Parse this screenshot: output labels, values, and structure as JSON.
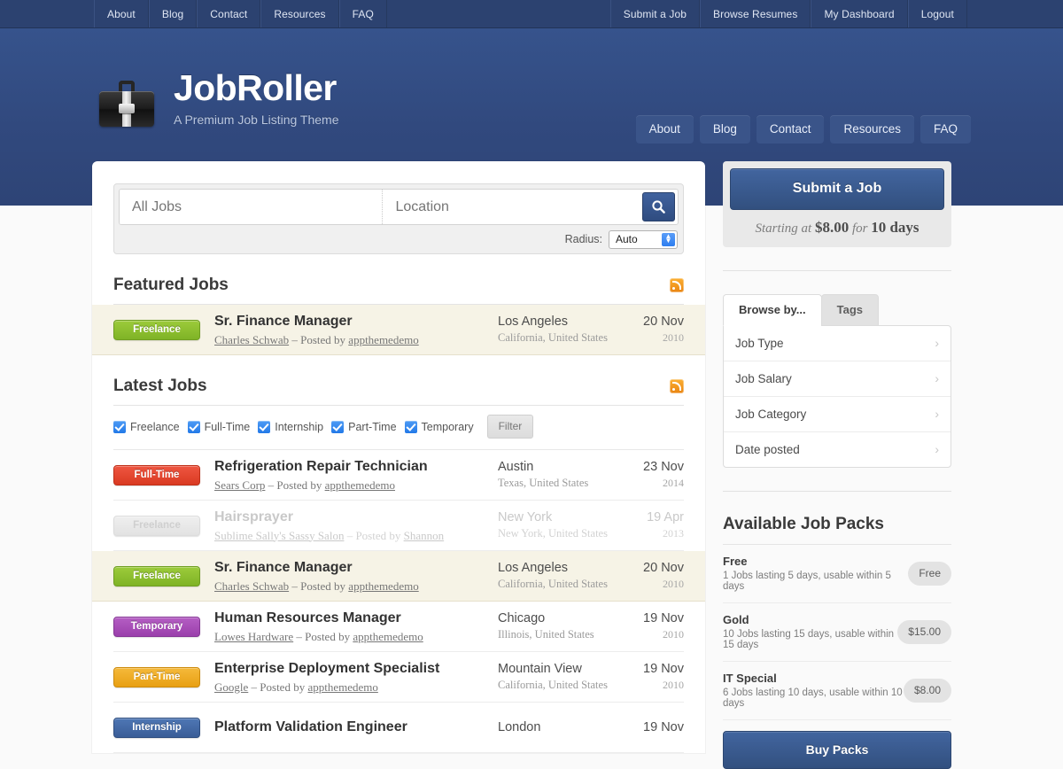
{
  "topbar": {
    "left_links": [
      "About",
      "Blog",
      "Contact",
      "Resources",
      "FAQ"
    ],
    "right_links": [
      "Submit a Job",
      "Browse Resumes",
      "My Dashboard",
      "Logout"
    ]
  },
  "header": {
    "logo_icon": "briefcase-icon",
    "title": "JobRoller",
    "tagline": "A Premium Job Listing Theme",
    "nav": [
      "About",
      "Blog",
      "Contact",
      "Resources",
      "FAQ"
    ],
    "background_color": "#31497e"
  },
  "search": {
    "keyword_placeholder": "All Jobs",
    "keyword_value": "",
    "location_placeholder": "Location",
    "location_value": "",
    "search_icon": "search-icon",
    "radius_label": "Radius:",
    "radius_value": "Auto"
  },
  "featured": {
    "heading": "Featured Jobs",
    "rss_icon": "rss-icon",
    "jobs": [
      {
        "badge": "Freelance",
        "badge_type": "freelance",
        "title": "Sr. Finance Manager",
        "company": "Charles Schwab",
        "posted_prefix": "– Posted by",
        "poster": "appthemedemo",
        "city": "Los Angeles",
        "region": "California, United States",
        "date_day": "20 Nov",
        "date_year": "2010"
      }
    ]
  },
  "latest": {
    "heading": "Latest Jobs",
    "rss_icon": "rss-icon",
    "filters": [
      {
        "label": "Freelance",
        "checked": true
      },
      {
        "label": "Full-Time",
        "checked": true
      },
      {
        "label": "Internship",
        "checked": true
      },
      {
        "label": "Part-Time",
        "checked": true
      },
      {
        "label": "Temporary",
        "checked": true
      }
    ],
    "filter_button": "Filter",
    "jobs": [
      {
        "badge": "Full-Time",
        "badge_type": "fulltime",
        "title": "Refrigeration Repair Technician",
        "company": "Sears Corp",
        "posted_prefix": "– Posted by",
        "poster": "appthemedemo",
        "city": "Austin",
        "region": "Texas, United States",
        "date_day": "23 Nov",
        "date_year": "2014",
        "state": "active"
      },
      {
        "badge": "Freelance",
        "badge_type": "expired",
        "title": "Hairsprayer",
        "company": "Sublime Sally's Sassy Salon",
        "posted_prefix": "– Posted by",
        "poster": "Shannon",
        "city": "New York",
        "region": "New York, United States",
        "date_day": "19 Apr",
        "date_year": "2013",
        "state": "expired"
      },
      {
        "badge": "Freelance",
        "badge_type": "freelance",
        "title": "Sr. Finance Manager",
        "company": "Charles Schwab",
        "posted_prefix": "– Posted by",
        "poster": "appthemedemo",
        "city": "Los Angeles",
        "region": "California, United States",
        "date_day": "20 Nov",
        "date_year": "2010",
        "state": "featured"
      },
      {
        "badge": "Temporary",
        "badge_type": "temporary",
        "title": "Human Resources Manager",
        "company": "Lowes Hardware",
        "posted_prefix": "– Posted by",
        "poster": "appthemedemo",
        "city": "Chicago",
        "region": "Illinois, United States",
        "date_day": "19 Nov",
        "date_year": "2010",
        "state": "active"
      },
      {
        "badge": "Part-Time",
        "badge_type": "parttime",
        "title": "Enterprise Deployment Specialist",
        "company": "Google",
        "posted_prefix": "– Posted by",
        "poster": "appthemedemo",
        "city": "Mountain View",
        "region": "California, United States",
        "date_day": "19 Nov",
        "date_year": "2010",
        "state": "active"
      },
      {
        "badge": "Internship",
        "badge_type": "internship",
        "title": "Platform Validation Engineer",
        "company": "",
        "posted_prefix": "",
        "poster": "",
        "city": "London",
        "region": "",
        "date_day": "19 Nov",
        "date_year": "",
        "state": "active"
      }
    ]
  },
  "sidebar": {
    "submit_button": "Submit a Job",
    "submit_note_prefix": "Starting at",
    "submit_note_price": "$8.00",
    "submit_note_middle": "for",
    "submit_note_days": "10 days",
    "tabs": [
      {
        "label": "Browse by...",
        "active": true
      },
      {
        "label": "Tags",
        "active": false
      }
    ],
    "browse_items": [
      "Job Type",
      "Job Salary",
      "Job Category",
      "Date posted"
    ],
    "chevron_icon": "chevron-right-icon",
    "packs_title": "Available Job Packs",
    "packs": [
      {
        "name": "Free",
        "desc": "1 Jobs lasting 5 days, usable within 5 days",
        "price": "Free"
      },
      {
        "name": "Gold",
        "desc": "10 Jobs lasting 15 days, usable within 15 days",
        "price": "$15.00"
      },
      {
        "name": "IT Special",
        "desc": "6 Jobs lasting 10 days, usable within 10 days",
        "price": "$8.00"
      }
    ],
    "buy_button": "Buy Packs"
  }
}
